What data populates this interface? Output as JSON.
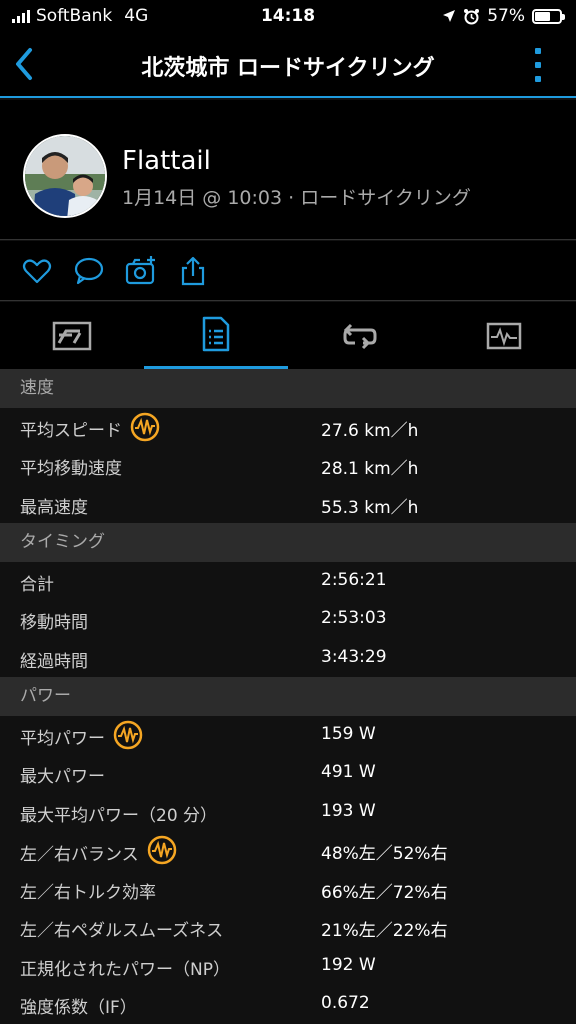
{
  "status_bar": {
    "carrier": "SoftBank",
    "network": "4G",
    "time": "14:18",
    "battery_percent": "57%",
    "battery_level": 0.57
  },
  "nav": {
    "title": "北茨城市 ロードサイクリング",
    "back_icon": "chevron-left-icon",
    "more_icon": "more-vertical-icon"
  },
  "profile": {
    "name": "Flattail",
    "meta": "1月14日 @ 10:03 · ロードサイクリング"
  },
  "actions": [
    "heart-icon",
    "comment-icon",
    "camera-add-icon",
    "share-icon"
  ],
  "tabs": [
    {
      "icon": "overview-icon",
      "active": false
    },
    {
      "icon": "stats-list-icon",
      "active": true
    },
    {
      "icon": "laps-icon",
      "active": false
    },
    {
      "icon": "chart-icon",
      "active": false
    }
  ],
  "colors": {
    "accent": "#1f9bde",
    "power_badge": "#f5a623",
    "section_bg": "#2c2c2c",
    "row_bg": "#111111"
  },
  "sections": [
    {
      "title": "速度",
      "rows": [
        {
          "label": "平均スピード",
          "value": "27.6 km／h",
          "badge": true
        },
        {
          "label": "平均移動速度",
          "value": "28.1 km／h",
          "badge": false
        },
        {
          "label": "最高速度",
          "value": "55.3 km／h",
          "badge": false
        }
      ]
    },
    {
      "title": "タイミング",
      "rows": [
        {
          "label": "合計",
          "value": "2:56:21",
          "badge": false
        },
        {
          "label": "移動時間",
          "value": "2:53:03",
          "badge": false
        },
        {
          "label": "経過時間",
          "value": "3:43:29",
          "badge": false
        }
      ]
    },
    {
      "title": "パワー",
      "rows": [
        {
          "label": "平均パワー",
          "value": "159 W",
          "badge": true
        },
        {
          "label": "最大パワー",
          "value": "491 W",
          "badge": false
        },
        {
          "label": "最大平均パワー（20 分）",
          "value": "193 W",
          "badge": false
        },
        {
          "label": "左／右バランス",
          "value": "48%左／52%右",
          "badge": true
        },
        {
          "label": "左／右トルク効率",
          "value": "66%左／72%右",
          "badge": false
        },
        {
          "label": "左／右ペダルスムーズネス",
          "value": "21%左／22%右",
          "badge": false
        },
        {
          "label": "正規化されたパワー（NP）",
          "value": "192 W",
          "badge": false
        },
        {
          "label": "強度係数（IF）",
          "value": "0.672",
          "badge": false
        }
      ]
    }
  ]
}
